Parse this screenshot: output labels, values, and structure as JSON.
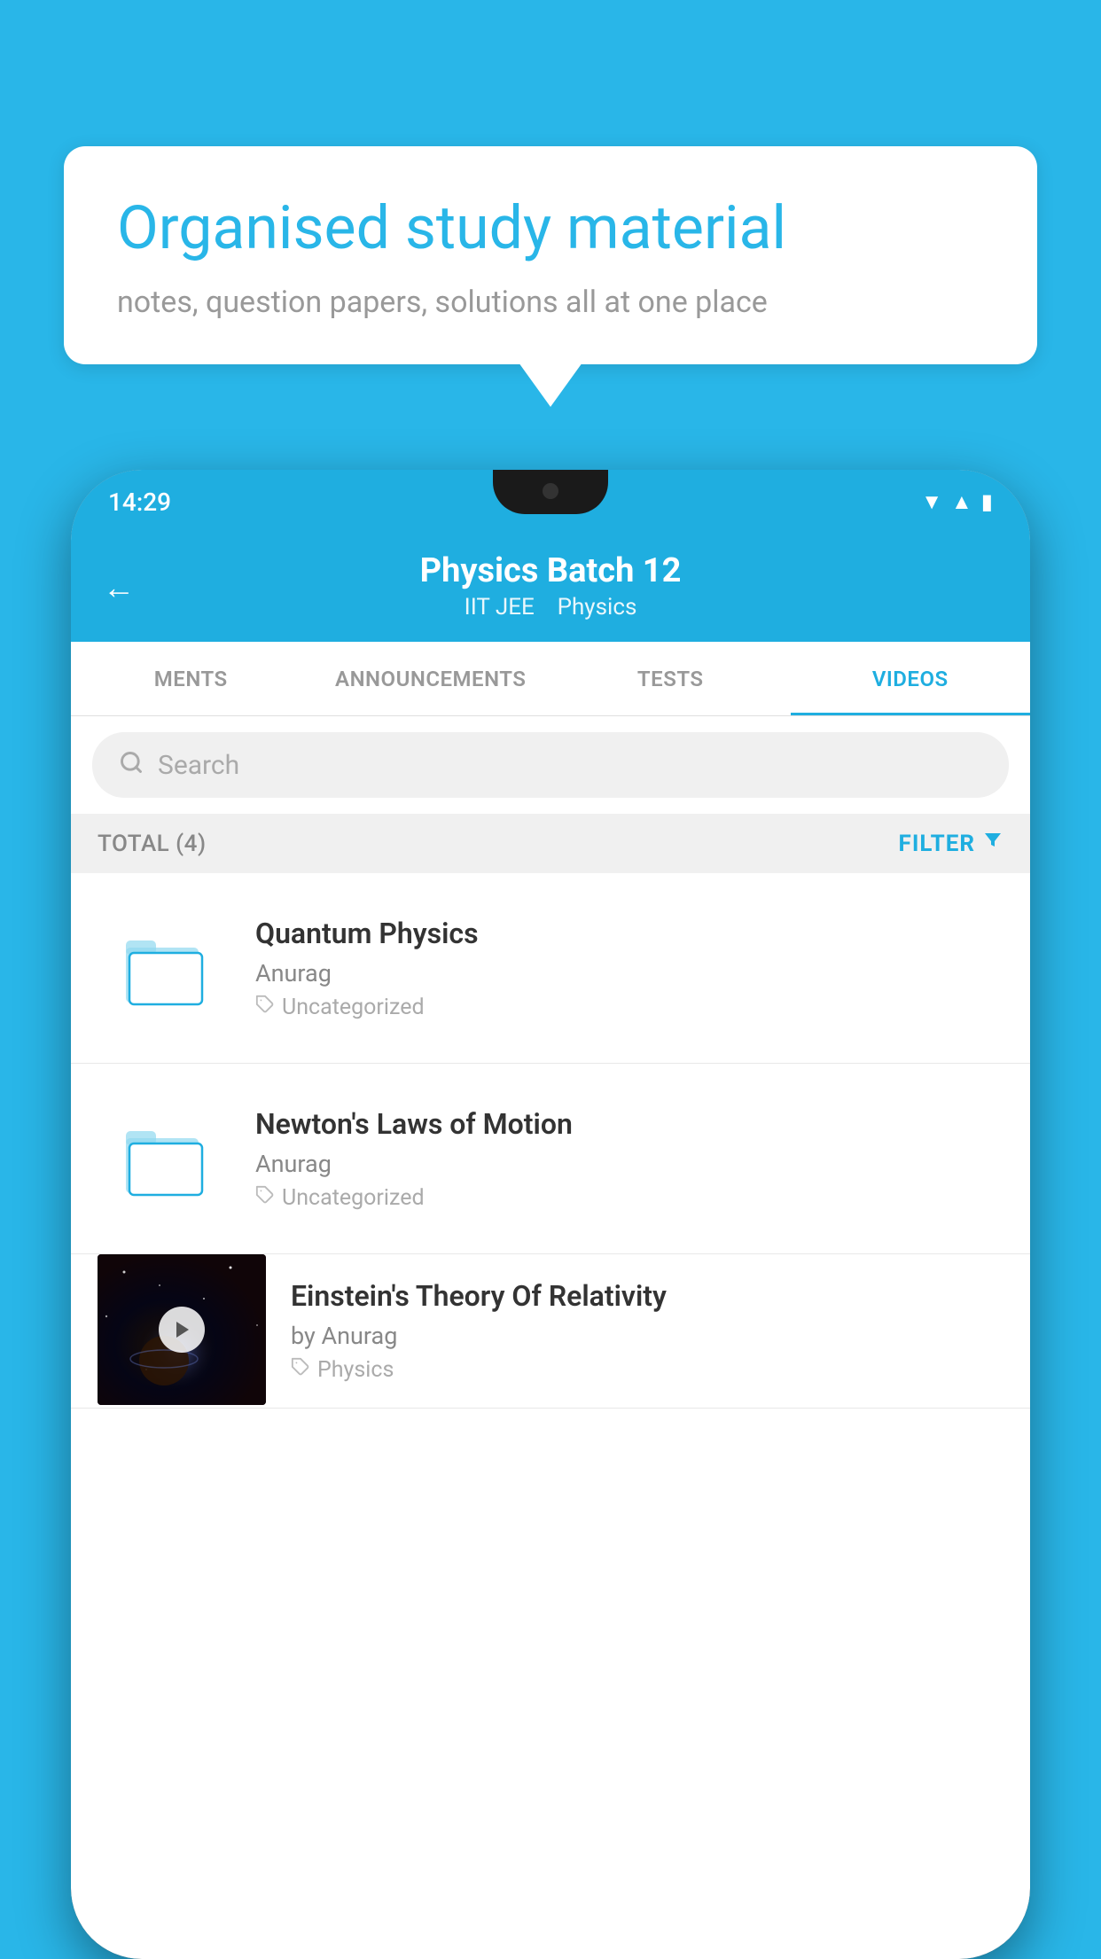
{
  "background_color": "#29b6e8",
  "speech_bubble": {
    "headline": "Organised study material",
    "subtext": "notes, question papers, solutions all at one place"
  },
  "phone": {
    "status_bar": {
      "time": "14:29"
    },
    "app_header": {
      "back_label": "←",
      "title": "Physics Batch 12",
      "subtitle_part1": "IIT JEE",
      "subtitle_part2": "Physics"
    },
    "tabs": [
      {
        "label": "MENTS",
        "active": false
      },
      {
        "label": "ANNOUNCEMENTS",
        "active": false
      },
      {
        "label": "TESTS",
        "active": false
      },
      {
        "label": "VIDEOS",
        "active": true
      }
    ],
    "search": {
      "placeholder": "Search"
    },
    "filter_bar": {
      "total_label": "TOTAL (4)",
      "filter_label": "FILTER"
    },
    "videos": [
      {
        "title": "Quantum Physics",
        "author": "Anurag",
        "tag": "Uncategorized",
        "type": "folder"
      },
      {
        "title": "Newton's Laws of Motion",
        "author": "Anurag",
        "tag": "Uncategorized",
        "type": "folder"
      },
      {
        "title": "Einstein's Theory Of Relativity",
        "author": "by Anurag",
        "tag": "Physics",
        "type": "video"
      }
    ]
  }
}
